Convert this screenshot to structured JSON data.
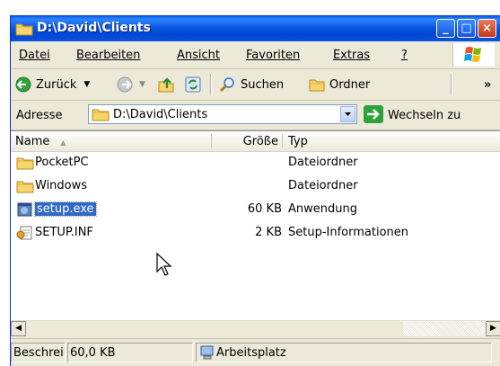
{
  "window": {
    "title": "D:\\David\\Clients",
    "controls": [
      "_",
      "□",
      "×"
    ]
  },
  "menu": [
    {
      "label": "Datei",
      "accel": "D"
    },
    {
      "label": "Bearbeiten",
      "accel": "B"
    },
    {
      "label": "Ansicht",
      "accel": "A"
    },
    {
      "label": "Favoriten",
      "accel": "F"
    },
    {
      "label": "Extras",
      "accel": "x"
    },
    {
      "label": "?",
      "accel": "?"
    }
  ],
  "toolbar": {
    "back_label": "Zurück",
    "search_label": "Suchen",
    "folders_label": "Ordner",
    "more": "»"
  },
  "address": {
    "label": "Adresse",
    "value": "D:\\David\\Clients",
    "go_label": "Wechseln zu"
  },
  "columns": {
    "name": "Name",
    "size": "Größe",
    "type": "Typ",
    "sort_indicator": "▲"
  },
  "files": [
    {
      "name": "PocketPC",
      "size": "",
      "type": "Dateiordner",
      "icon": "folder-icon"
    },
    {
      "name": "Windows",
      "size": "",
      "type": "Dateiordner",
      "icon": "folder-icon"
    },
    {
      "name": "setup.exe",
      "size": "60 KB",
      "type": "Anwendung",
      "icon": "application-icon",
      "selected": true
    },
    {
      "name": "SETUP.INF",
      "size": "2 KB",
      "type": "Setup-Informationen",
      "icon": "setup-info-icon"
    }
  ],
  "status": {
    "description": "Beschreib",
    "size": "60,0 KB",
    "location": "Arbeitsplatz"
  },
  "colors": {
    "title_blue": "#0054e3",
    "selection": "#316ac5",
    "chrome": "#ece9d8"
  }
}
